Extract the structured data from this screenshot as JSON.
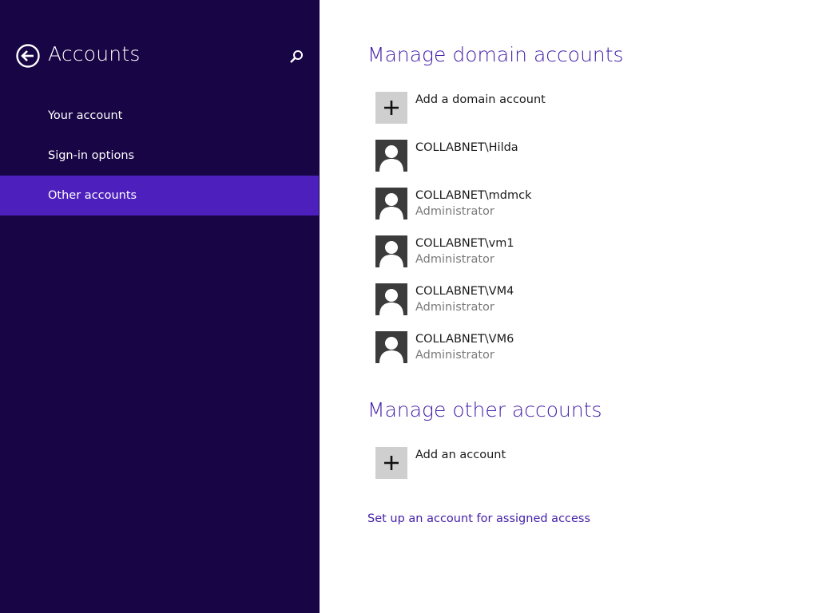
{
  "nav": {
    "title": "Accounts",
    "back_icon": "back-arrow-icon",
    "search_icon": "search-icon",
    "items": [
      {
        "label": "Your account",
        "selected": false
      },
      {
        "label": "Sign-in options",
        "selected": false
      },
      {
        "label": "Other accounts",
        "selected": true
      }
    ],
    "colors": {
      "background": "#180545",
      "selected": "#4d1fbd"
    }
  },
  "main": {
    "domain_section": {
      "title": "Manage domain accounts",
      "add_label": "Add a domain account",
      "accounts": [
        {
          "name": "COLLABNET\\Hilda",
          "role": ""
        },
        {
          "name": "COLLABNET\\mdmck",
          "role": "Administrator"
        },
        {
          "name": "COLLABNET\\vm1",
          "role": "Administrator"
        },
        {
          "name": "COLLABNET\\VM4",
          "role": "Administrator"
        },
        {
          "name": "COLLABNET\\VM6",
          "role": "Administrator"
        }
      ]
    },
    "other_section": {
      "title": "Manage other accounts",
      "add_label": "Add an account"
    },
    "assigned_access_link": "Set up an account for assigned access",
    "colors": {
      "accent": "#4520a8"
    }
  }
}
